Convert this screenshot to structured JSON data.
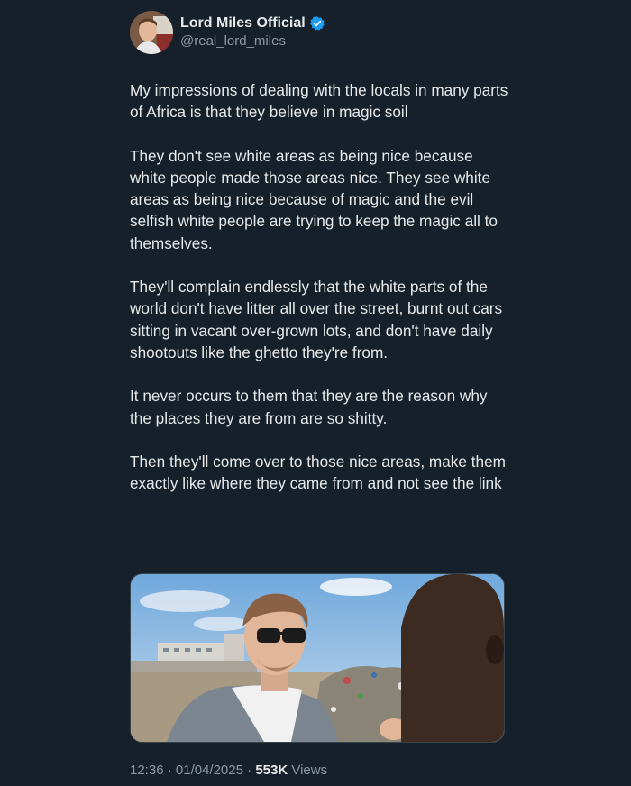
{
  "author": {
    "display_name": "Lord Miles Official",
    "handle": "@real_lord_miles",
    "verified_icon": "verified-badge-icon",
    "verified_color": "#1d9bf0"
  },
  "post": {
    "paragraphs": [
      "My impressions of dealing with the locals in many parts of Africa is that they believe in magic soil",
      "They don't see white areas as being nice because white people made those areas nice. They see white areas as being nice because of magic and the evil selfish white people are trying to keep the magic all to themselves.",
      "They'll complain endlessly that the white parts of the world don't have litter all over the street, burnt out cars sitting in vacant over-grown lots, and don't have daily shootouts like the ghetto they're from.",
      "It never occurs to them that they are the reason why the places they are from are so shitty.",
      "Then they'll come over to those nice areas, make them exactly like where they came from and not see the link"
    ]
  },
  "meta": {
    "time": "12:36",
    "separator": "·",
    "date": "01/04/2025",
    "views_count": "553K",
    "views_label": "Views"
  },
  "theme": {
    "background": "#15202b",
    "text": "#e7e9ea",
    "secondary_text": "#8b98a5"
  }
}
